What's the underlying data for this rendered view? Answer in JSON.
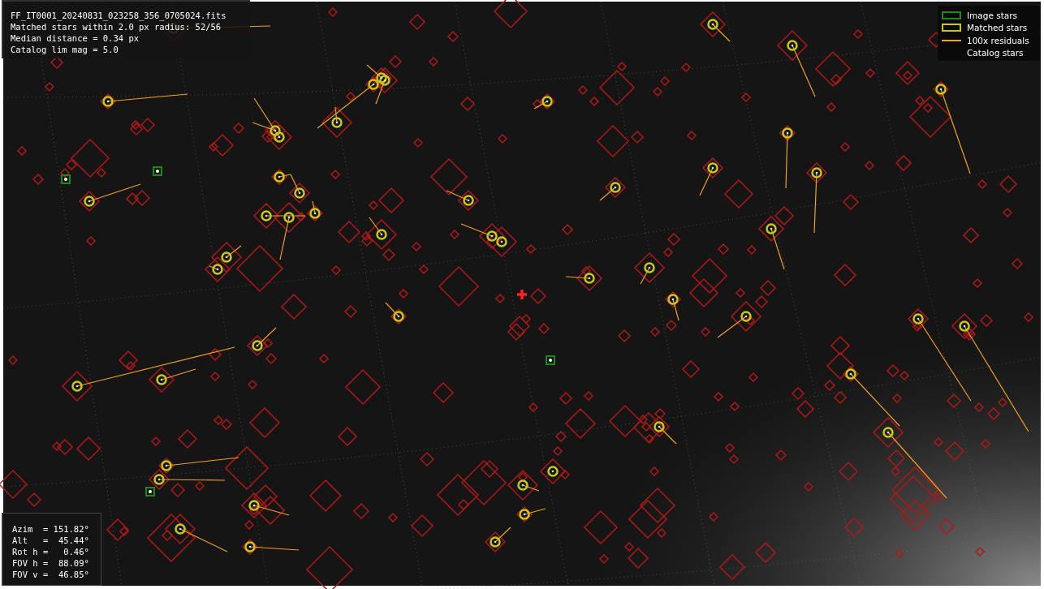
{
  "info": {
    "lines": [
      "FF_IT0001_20240831_023258_356_0705024.fits",
      "Matched stars within 2.0 px radius: 52/56",
      "Median distance = 0.34 px",
      "Catalog lim mag = 5.0"
    ]
  },
  "legend": [
    {
      "kind": "box",
      "label": "Image stars",
      "color": "#1a8a1a"
    },
    {
      "kind": "box",
      "label": "Matched stars",
      "color": "#c8c81a"
    },
    {
      "kind": "line",
      "label": "100x residuals",
      "color": "#f0a020"
    },
    {
      "kind": "none",
      "label": "Catalog stars"
    }
  ],
  "pointing": {
    "lines": [
      "Azim  = 151.82°",
      "Alt   =  45.44°",
      "Rot h =   0.46°",
      "FOV h =  88.09°",
      "FOV v =  46.85°"
    ]
  }
}
